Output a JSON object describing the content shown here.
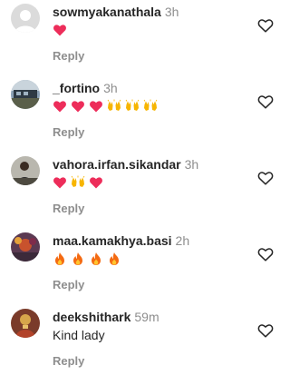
{
  "colors": {
    "username": "#262626",
    "meta": "#8e8e8e",
    "heart_emoji": "#ed2d5a",
    "like_outline": "#262626"
  },
  "comments": [
    {
      "username": "sowmyakanathala",
      "time": "3h",
      "text": "",
      "emojis": [
        "heart",
        "",
        "",
        "",
        "",
        ""
      ],
      "reply_label": "Reply",
      "avatar": "default-avatar"
    },
    {
      "username": "_fortino",
      "time": "3h",
      "text": "",
      "emojis": [
        "heart",
        "heart",
        "heart",
        "raising-hands",
        "raising-hands",
        "raising-hands"
      ],
      "reply_label": "Reply",
      "avatar": "photo-avatar"
    },
    {
      "username": "vahora.irfan.sikandar",
      "time": "3h",
      "text": "",
      "emojis": [
        "heart",
        "raising-hands",
        "heart",
        "",
        "",
        ""
      ],
      "reply_label": "Reply",
      "avatar": "photo-avatar"
    },
    {
      "username": "maa.kamakhya.basi",
      "time": "2h",
      "text": "",
      "emojis": [
        "fire",
        "fire",
        "fire",
        "fire",
        "",
        ""
      ],
      "reply_label": "Reply",
      "avatar": "photo-avatar"
    },
    {
      "username": "deekshithark",
      "time": "59m",
      "text": "Kind lady",
      "emojis": [],
      "reply_label": "Reply",
      "avatar": "photo-avatar"
    }
  ]
}
